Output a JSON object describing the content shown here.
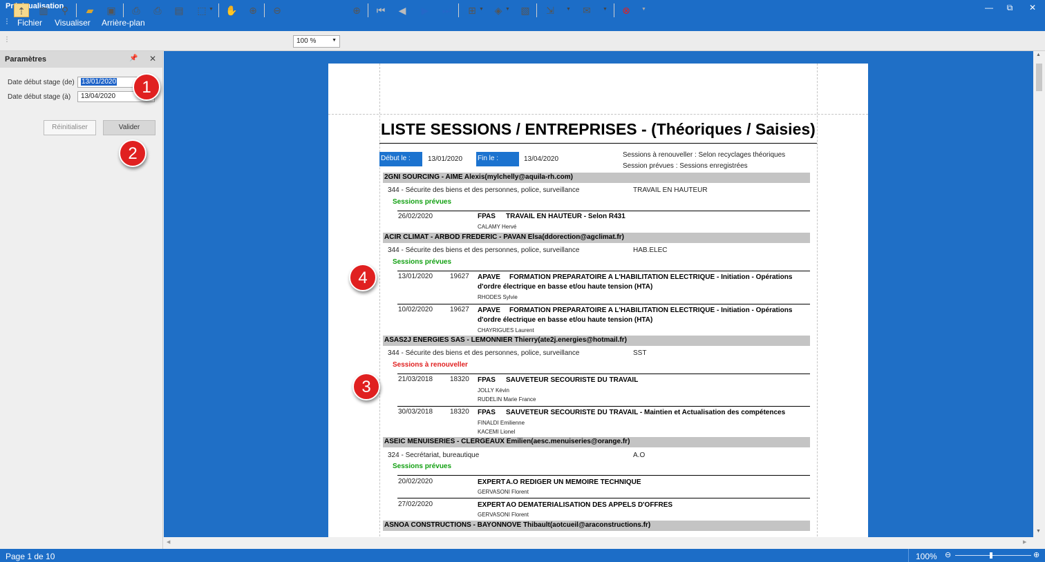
{
  "window": {
    "title": "Prévisualisation"
  },
  "menu": [
    "Fichier",
    "Visualiser",
    "Arrière-plan"
  ],
  "toolbar": {
    "zoom": "100 %"
  },
  "params": {
    "title": "Paramètres",
    "pin": "📌",
    "close": "✕",
    "label_from": "Date début stage (de)",
    "value_from": "13/01/2020",
    "label_to": "Date début stage (à)",
    "value_to": "13/04/2020",
    "reset": "Réinitialiser",
    "validate": "Valider"
  },
  "badges": [
    "1",
    "2",
    "3",
    "4"
  ],
  "report": {
    "title": "LISTE SESSIONS / ENTREPRISES - (Théoriques / Saisies)",
    "start_label": "Début le :",
    "start_value": "13/01/2020",
    "end_label": "Fin le :",
    "end_value": "13/04/2020",
    "legend1": "Sessions à renouveller : Selon recyclages théoriques",
    "legend2": "Session prévues : Sessions enregistrées",
    "companies": [
      {
        "name": "2GNI SOURCING - AIME Alexis(mylchelly@aquila-rh.com)",
        "domain": "344 - Sécurite des biens et des personnes, police, surveillance",
        "topic": "TRAVAIL EN HAUTEUR",
        "status": "Sessions prévues",
        "sessions": [
          {
            "date": "26/02/2020",
            "num": "",
            "org": "FPAS",
            "title": "TRAVAIL EN HAUTEUR - Selon R431",
            "title2": "",
            "people": [
              "CALAMY Hervé"
            ]
          }
        ]
      },
      {
        "name": "ACIR CLIMAT - ARBOD FREDERIC - PAVAN Elsa(ddorection@agclimat.fr)",
        "domain": "344 - Sécurite des biens et des personnes, police, surveillance",
        "topic": "HAB.ELEC",
        "status": "Sessions prévues",
        "sessions": [
          {
            "date": "13/01/2020",
            "num": "19627",
            "org": "APAVE",
            "title": "FORMATION PREPARATOIRE A L'HABILITATION ELECTRIQUE - Initiation - Opérations",
            "title2": "d'ordre électrique en basse et/ou haute tension (HTA)",
            "people": [
              "RHODES Sylvie"
            ]
          },
          {
            "date": "10/02/2020",
            "num": "19627",
            "org": "APAVE",
            "title": "FORMATION PREPARATOIRE A L'HABILITATION ELECTRIQUE - Initiation - Opérations",
            "title2": "d'ordre électrique en basse et/ou haute tension (HTA)",
            "people": [
              "CHAYRIGUES Laurent"
            ]
          }
        ]
      },
      {
        "name": "ASAS2J ENERGIES SAS - LEMONNIER Thierry(ate2j.energies@hotmail.fr)",
        "domain": "344 - Sécurite des biens et des personnes, police, surveillance",
        "topic": "SST",
        "status": "Sessions à renouveller",
        "sessions": [
          {
            "date": "21/03/2018",
            "num": "18320",
            "org": "FPAS",
            "title": "SAUVETEUR SECOURISTE DU TRAVAIL",
            "title2": "",
            "people": [
              "JOLLY Kévin",
              "RUDELIN Marie France"
            ]
          },
          {
            "date": "30/03/2018",
            "num": "18320",
            "org": "FPAS",
            "title": "SAUVETEUR SECOURISTE DU TRAVAIL - Maintien et Actualisation des compétences",
            "title2": "",
            "people": [
              "FINALDI Emilienne",
              "KACEMI Lionel"
            ]
          }
        ]
      },
      {
        "name": "ASEIC MENUISERIES - CLERGEAUX Emilien(aesc.menuiseries@orange.fr)",
        "domain": "324 - Secrétariat, bureautique",
        "topic": "A.O",
        "status": "Sessions prévues",
        "sessions": [
          {
            "date": "20/02/2020",
            "num": "",
            "org": "EXPERT",
            "title": "A.O REDIGER UN MEMOIRE TECHNIQUE",
            "title2": "",
            "people": [
              "GERVASONI Florent"
            ]
          },
          {
            "date": "27/02/2020",
            "num": "",
            "org": "EXPERT",
            "title": "AO  DEMATERIALISATION DES APPELS D'OFFRES",
            "title2": "",
            "people": [
              "GERVASONI Florent"
            ]
          }
        ]
      },
      {
        "name": "ASNOA CONSTRUCTIONS - BAYONNOVE Thibault(aotcueil@araconstructions.fr)",
        "domain": "",
        "topic": "",
        "status": "",
        "sessions": []
      }
    ]
  },
  "status": {
    "page": "Page 1 de 10",
    "zoom": "100%"
  },
  "colors": {
    "titlebar": "#1c6dc7",
    "preview_bg": "#1f6fc6",
    "badge": "#e02020",
    "header_box": "#1c73cf",
    "group_bar": "#c4c4c4",
    "green": "#12a012",
    "red": "#e02020"
  }
}
